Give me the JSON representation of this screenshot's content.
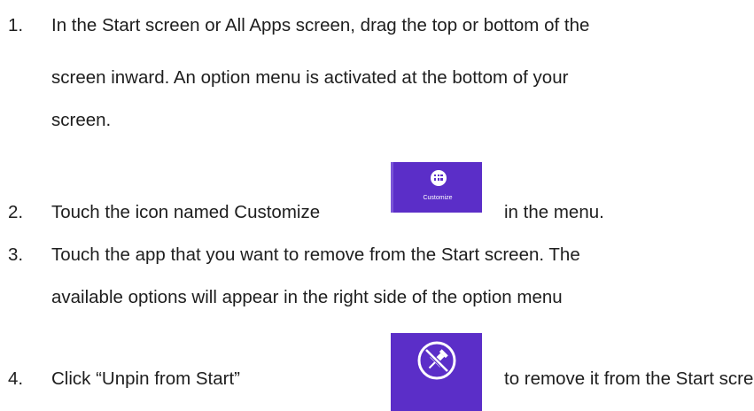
{
  "steps": [
    {
      "number": "1.",
      "lines": [
        "In the Start screen or All Apps screen, drag the top or bottom of the",
        "screen inward. An option menu is activated at the bottom of your",
        "screen."
      ]
    },
    {
      "number": "2.",
      "before": "Touch the icon named Customize",
      "after": "in the menu."
    },
    {
      "number": "3.",
      "lines": [
        "Touch the app that you want to remove from the Start screen. The",
        "available options will appear in the right side of the option menu"
      ]
    },
    {
      "number": "4.",
      "before": "Click “Unpin from Start”",
      "after": "to remove it from the Start screen."
    }
  ],
  "tiles": {
    "customize": {
      "label": "Customize",
      "icon": "customize-grid-icon",
      "color": "#5b2ec8"
    },
    "unpin": {
      "icon": "unpin-icon",
      "color": "#5b2ec8"
    }
  },
  "colors": {
    "text": "#1e1e1e",
    "tile_background": "#5b2ec8",
    "tile_foreground": "#ffffff"
  }
}
